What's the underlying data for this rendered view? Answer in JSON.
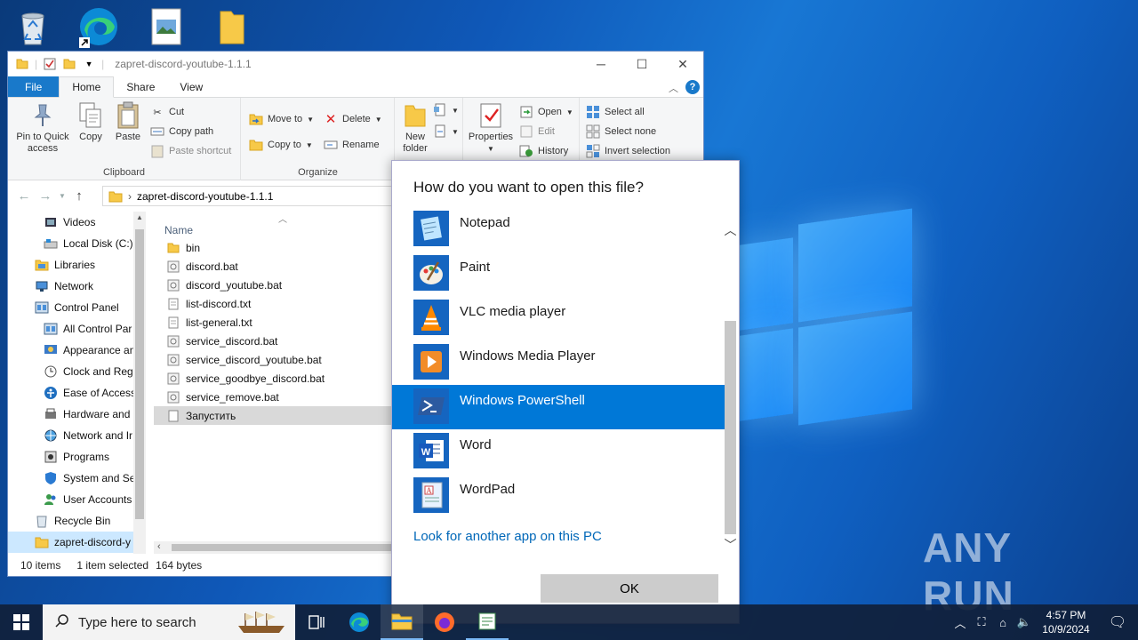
{
  "explorer": {
    "title": "zapret-discord-youtube-1.1.1",
    "tabs": [
      "File",
      "Home",
      "Share",
      "View"
    ],
    "ribbon": {
      "pin_label": "Pin to Quick access",
      "copy_label": "Copy",
      "paste_label": "Paste",
      "cut_label": "Cut",
      "copy_path_label": "Copy path",
      "paste_shortcut_label": "Paste shortcut",
      "clipboard_group": "Clipboard",
      "move_to_label": "Move to",
      "copy_to_label": "Copy to",
      "delete_label": "Delete",
      "rename_label": "Rename",
      "organize_group": "Organize",
      "new_folder_label": "New folder",
      "properties_label": "Properties",
      "open_label": "Open",
      "edit_label": "Edit",
      "history_label": "History",
      "select_all_label": "Select all",
      "select_none_label": "Select none",
      "invert_selection_label": "Invert selection"
    },
    "address_path": "zapret-discord-youtube-1.1.1",
    "nav_items": [
      {
        "label": "Videos",
        "icon": "videos-icon"
      },
      {
        "label": "Local Disk (C:)",
        "icon": "disk-icon"
      },
      {
        "label": "Libraries",
        "icon": "libraries-icon"
      },
      {
        "label": "Network",
        "icon": "network-icon"
      },
      {
        "label": "Control Panel",
        "icon": "control-panel-icon"
      },
      {
        "label": "All Control Par",
        "icon": "control-panel-icon"
      },
      {
        "label": "Appearance an",
        "icon": "appearance-icon"
      },
      {
        "label": "Clock and Regi",
        "icon": "clock-icon"
      },
      {
        "label": "Ease of Access",
        "icon": "ease-icon"
      },
      {
        "label": "Hardware and",
        "icon": "hardware-icon"
      },
      {
        "label": "Network and Ir",
        "icon": "network-icon"
      },
      {
        "label": "Programs",
        "icon": "programs-icon"
      },
      {
        "label": "System and Sec",
        "icon": "shield-icon"
      },
      {
        "label": "User Accounts",
        "icon": "users-icon"
      },
      {
        "label": "Recycle Bin",
        "icon": "recycle-bin-icon"
      },
      {
        "label": "zapret-discord-y",
        "icon": "folder-icon"
      }
    ],
    "column_name": "Name",
    "files": [
      {
        "name": "bin",
        "type": "folder"
      },
      {
        "name": "discord.bat",
        "type": "bat"
      },
      {
        "name": "discord_youtube.bat",
        "type": "bat"
      },
      {
        "name": "list-discord.txt",
        "type": "txt"
      },
      {
        "name": "list-general.txt",
        "type": "txt"
      },
      {
        "name": "service_discord.bat",
        "type": "bat"
      },
      {
        "name": "service_discord_youtube.bat",
        "type": "bat"
      },
      {
        "name": "service_goodbye_discord.bat",
        "type": "bat"
      },
      {
        "name": "service_remove.bat",
        "type": "bat"
      },
      {
        "name": "Запустить",
        "type": "file"
      }
    ],
    "status": {
      "items": "10 items",
      "selected": "1 item selected",
      "size": "164 bytes"
    }
  },
  "dialog": {
    "title": "How do you want to open this file?",
    "apps": [
      {
        "name": "Notepad",
        "icon": "notepad-icon"
      },
      {
        "name": "Paint",
        "icon": "paint-icon"
      },
      {
        "name": "VLC media player",
        "icon": "vlc-icon"
      },
      {
        "name": "Windows Media Player",
        "icon": "media-player-icon"
      },
      {
        "name": "Windows PowerShell",
        "icon": "powershell-icon"
      },
      {
        "name": "Word",
        "icon": "word-icon"
      },
      {
        "name": "WordPad",
        "icon": "wordpad-icon"
      }
    ],
    "selected_app": "Windows PowerShell",
    "link": "Look for another app on this PC",
    "ok_label": "OK"
  },
  "taskbar": {
    "search_placeholder": "Type here to search",
    "time": "4:57 PM",
    "date": "10/9/2024"
  },
  "watermark": "ANY RUN",
  "colors": {
    "accent": "#0078d7",
    "file_tab": "#1979ca",
    "link": "#0067b8"
  }
}
